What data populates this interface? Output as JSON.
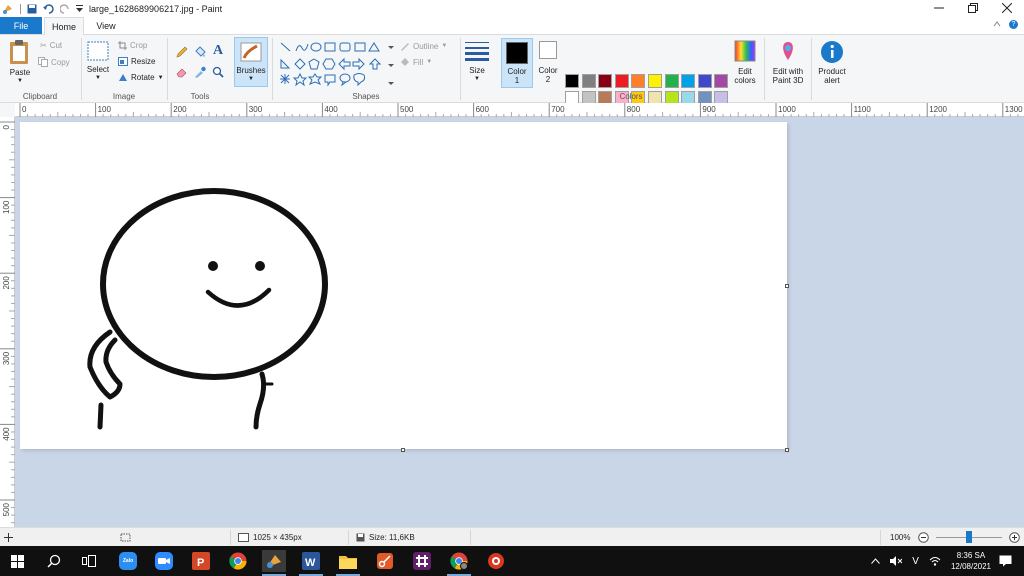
{
  "window": {
    "title": "large_1628689906217.jpg - Paint",
    "controls": [
      "minimize",
      "restore",
      "close"
    ]
  },
  "menu": {
    "tabs": [
      {
        "label": "File"
      },
      {
        "label": "Home"
      },
      {
        "label": "View"
      }
    ]
  },
  "ribbon": {
    "clipboard": {
      "group_label": "Clipboard",
      "paste": "Paste",
      "cut": "Cut",
      "copy": "Copy"
    },
    "image": {
      "group_label": "Image",
      "select": "Select",
      "crop": "Crop",
      "resize": "Resize",
      "rotate": "Rotate"
    },
    "tools": {
      "group_label": "Tools",
      "text_glyph": "A"
    },
    "brushes": {
      "label": "Brushes"
    },
    "shapes": {
      "group_label": "Shapes",
      "outline": "Outline",
      "fill": "Fill"
    },
    "size": {
      "label": "Size"
    },
    "color1": {
      "label_line1": "Color",
      "label_line2": "1",
      "color": "#000000"
    },
    "color2": {
      "label_line1": "Color",
      "label_line2": "2",
      "color": "#ffffff"
    },
    "colors": {
      "group_label": "Colors",
      "palette_row1": [
        "#000000",
        "#7f7f7f",
        "#880015",
        "#ed1c24",
        "#ff7f27",
        "#fff200",
        "#22b14c",
        "#00a2e8",
        "#3f48cc",
        "#a349a4"
      ],
      "palette_row2": [
        "#ffffff",
        "#c3c3c3",
        "#b97a57",
        "#ffaec9",
        "#ffc90e",
        "#efe4b0",
        "#b5e61d",
        "#99d9ea",
        "#7092be",
        "#c8bfe7"
      ]
    },
    "edit_colors": {
      "line1": "Edit",
      "line2": "colors"
    },
    "paint3d": {
      "line1": "Edit with",
      "line2": "Paint 3D"
    },
    "product_alert": {
      "line1": "Product",
      "line2": "alert"
    }
  },
  "ruler": {
    "h_ticks": [
      "0",
      "100",
      "200",
      "300",
      "400",
      "500",
      "600",
      "700",
      "800",
      "900",
      "1000",
      "1100",
      "1200",
      "1300"
    ],
    "v_ticks": [
      "0",
      "100",
      "200",
      "300",
      "400",
      "500"
    ]
  },
  "status": {
    "dimensions": "1025 × 435px",
    "size": "Size: 11,6KB",
    "zoom": "100%",
    "zoom_fraction": 0.5
  },
  "taskbar": {
    "apps": [
      "start",
      "search",
      "task-view",
      "zalo",
      "zoom",
      "powerpoint",
      "chrome",
      "paint",
      "word",
      "file-explorer",
      "snipping",
      "slack",
      "chrome-profile",
      "app-red"
    ],
    "zalo_label": "Zalo",
    "tray_input": "V",
    "time": "8:36 SA",
    "date": "12/08/2021"
  }
}
